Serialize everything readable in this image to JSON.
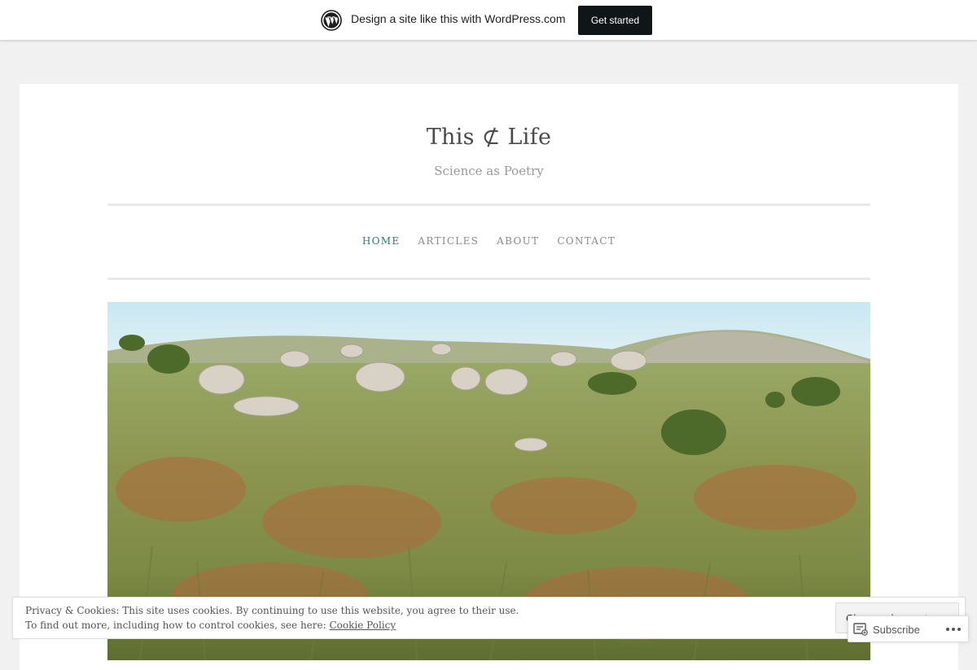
{
  "banner": {
    "text": "Design a site like this with WordPress.com",
    "cta_label": "Get started",
    "logo_icon": "wordpress-logo-icon"
  },
  "site": {
    "title": "This ⊄ Life",
    "tagline": "Science as Poetry",
    "accent_color": "#2a7c7a"
  },
  "nav": {
    "items": [
      {
        "label": "HOME",
        "active": true
      },
      {
        "label": "ARTICLES",
        "active": false
      },
      {
        "label": "ABOUT",
        "active": false
      },
      {
        "label": "CONTACT",
        "active": false
      }
    ]
  },
  "cookie": {
    "line1": "Privacy & Cookies: This site uses cookies. By continuing to use this website, you agree to their use.",
    "line2_prefix": "To find out more, including how to control cookies, see here: ",
    "policy_link": "Cookie Policy",
    "close_label": "Close and accept"
  },
  "subscribe": {
    "label": "Subscribe",
    "icon": "reader-subscribe-icon",
    "more_icon": "ellipsis-icon"
  }
}
